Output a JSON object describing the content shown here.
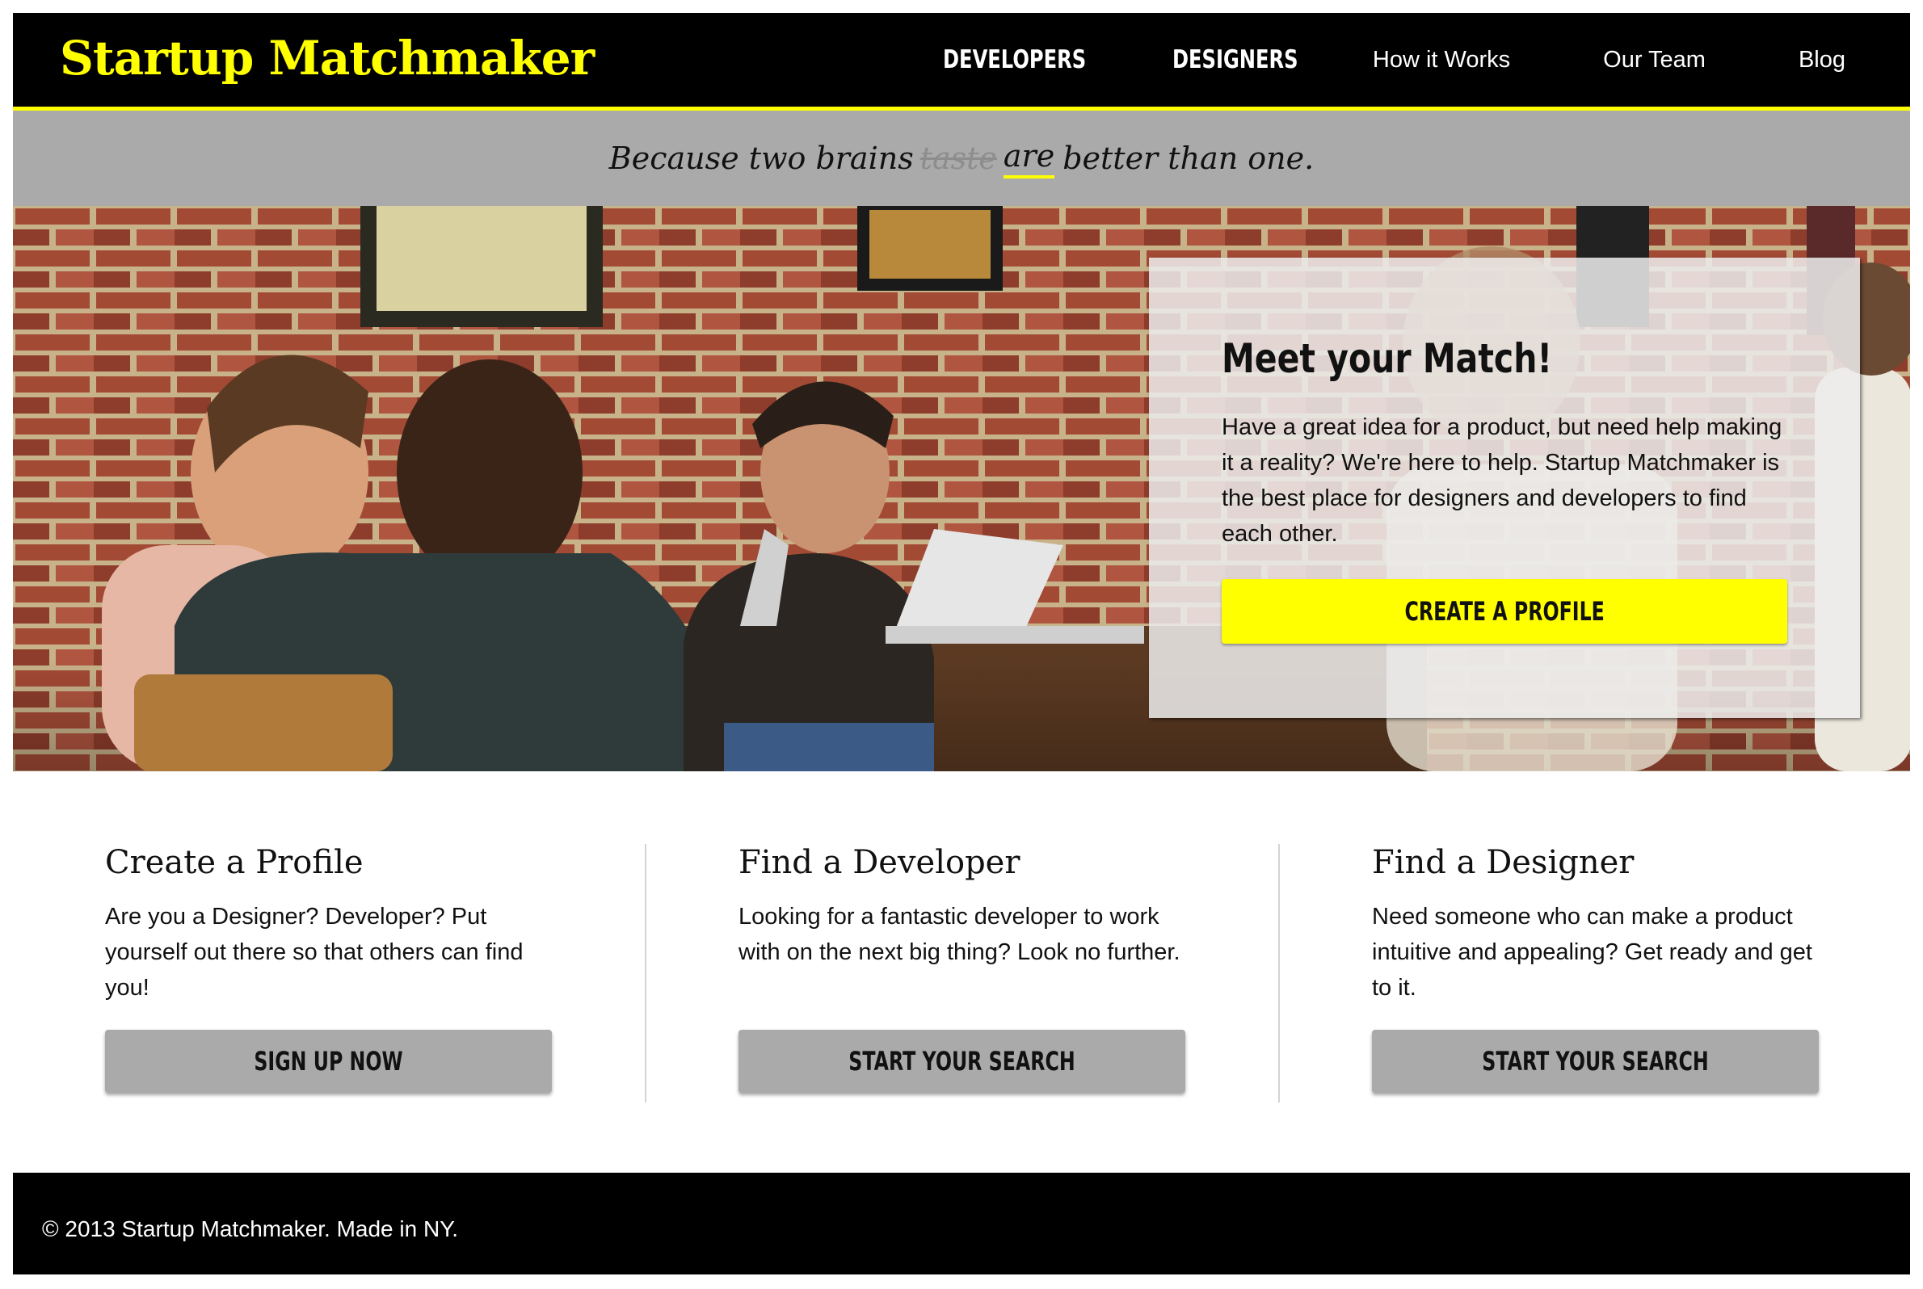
{
  "header": {
    "logo": "Startup Matchmaker",
    "nav": [
      "DEVELOPERS",
      "DESIGNERS",
      "How it Works",
      "Our Team",
      "Blog"
    ]
  },
  "tagline": {
    "start": "Because two brains",
    "struck": "taste",
    "underlined": "are",
    "end": "better than one."
  },
  "hero": {
    "title": "Meet your Match!",
    "body": "Have a great idea for a product, but need help making it a reality? We're here to help. Startup Matchmaker is the best place for designers and developers to find each other.",
    "button": "CREATE A PROFILE"
  },
  "features": [
    {
      "title": "Create a Profile",
      "body": "Are you a Designer? Developer? Put yourself out there so that others can find you!",
      "button": "SIGN UP NOW"
    },
    {
      "title": "Find a Developer",
      "body": "Looking for a fantastic developer to work with on the next big thing? Look no further.",
      "button": "START YOUR SEARCH"
    },
    {
      "title": "Find a Designer",
      "body": "Need someone who can make a product intuitive and appealing? Get ready and get to it.",
      "button": "START YOUR SEARCH"
    }
  ],
  "footer": {
    "text": "© 2013 Startup Matchmaker. Made in NY."
  },
  "colors": {
    "accent": "#ffff00",
    "header_bg": "#000000",
    "tagline_bg": "#aaaaaa",
    "button_gray": "#aaaaaa"
  }
}
